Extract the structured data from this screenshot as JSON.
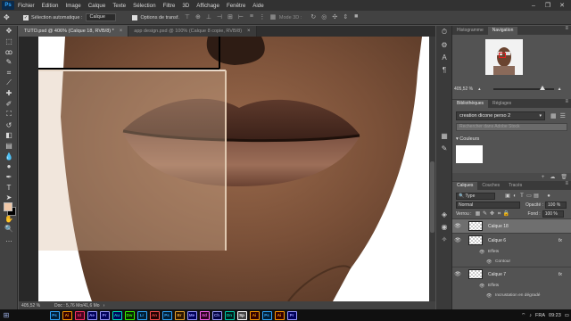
{
  "menu": [
    "Fichier",
    "Edition",
    "Image",
    "Calque",
    "Texte",
    "Sélection",
    "Filtre",
    "3D",
    "Affichage",
    "Fenêtre",
    "Aide"
  ],
  "app_logo": "Ps",
  "window_controls": [
    "–",
    "❐",
    "✕"
  ],
  "options_bar": {
    "auto_select_label": "Sélection automatique :",
    "auto_select_value": "Calque",
    "transform_label": "Options de transf.",
    "mode3d_label": "Mode 3D :"
  },
  "doc_tabs": [
    {
      "label": "TUTO.psd @ 406% (Calque 18, RVB/8) *",
      "close": "×"
    },
    {
      "label": "app design.psd @ 100% (Calque 8 copie, RVB/8)",
      "close": "×"
    }
  ],
  "status": {
    "zoom": "405,52 %",
    "doc": "Doc : 5,76 Mo/41,6 Mo",
    "arrow": "›"
  },
  "navigator": {
    "tabs": [
      "Histogramme",
      "Navigation"
    ],
    "active_tab": "Navigation",
    "zoom": "405,52 %",
    "zoom_value": 405.52
  },
  "libraries": {
    "tabs": [
      "Bibliothèques",
      "Réglages"
    ],
    "active_tab": "Bibliothèques",
    "library": "creation dicone perso 2",
    "search_placeholder": "Rechercher dans Adobe Stock",
    "section": "Couleurs",
    "color": "#ffffff"
  },
  "layers": {
    "tabs": [
      "Calques",
      "Couches",
      "Tracés"
    ],
    "active_tab": "Calques",
    "filter": "Type",
    "blend_mode": "Normal",
    "opacity_label": "Opacité :",
    "opacity": "100 %",
    "lock_label": "Verrou :",
    "fill_label": "Fond :",
    "fill": "100 %",
    "items": [
      {
        "name": "Calque 18",
        "selected": true,
        "fx": false,
        "effects": []
      },
      {
        "name": "Calque 6",
        "selected": false,
        "fx": true,
        "effects_label": "Effets",
        "effects": [
          "Contour"
        ]
      },
      {
        "name": "Calque 7",
        "selected": false,
        "fx": true,
        "effects_label": "Effets",
        "effects": [
          "Incrustation en dégradé"
        ]
      }
    ],
    "fx_label": "fx"
  },
  "taskbar": {
    "apps": [
      {
        "label": "Ps",
        "color": "#31a8ff",
        "bg": "#001e36"
      },
      {
        "label": "Ai",
        "color": "#ff9a00",
        "bg": "#330000"
      },
      {
        "label": "Id",
        "color": "#ff3366",
        "bg": "#49021f"
      },
      {
        "label": "Ae",
        "color": "#9999ff",
        "bg": "#00005b"
      },
      {
        "label": "Pr",
        "color": "#9999ff",
        "bg": "#00005b"
      },
      {
        "label": "Au",
        "color": "#00e4bb",
        "bg": "#00005b"
      },
      {
        "label": "Dw",
        "color": "#35fa00",
        "bg": "#072401"
      },
      {
        "label": "Lr",
        "color": "#31a8ff",
        "bg": "#001e36"
      },
      {
        "label": "An",
        "color": "#ff4d4d",
        "bg": "#210000"
      },
      {
        "label": "Ps",
        "color": "#31a8ff",
        "bg": "#001e36"
      },
      {
        "label": "Br",
        "color": "#e7a42c",
        "bg": "#2b1500"
      },
      {
        "label": "Me",
        "color": "#9999ff",
        "bg": "#00005b"
      },
      {
        "label": "Xd",
        "color": "#ff61f6",
        "bg": "#2e001f"
      },
      {
        "label": "Ch",
        "color": "#a2a3ff",
        "bg": "#000041"
      },
      {
        "label": "Dn",
        "color": "#00d2ae",
        "bg": "#001b19"
      },
      {
        "label": "Sp",
        "color": "#ffffff",
        "bg": "#444444"
      },
      {
        "label": "Ai",
        "color": "#ff9a00",
        "bg": "#330000"
      },
      {
        "label": "Ps",
        "color": "#31a8ff",
        "bg": "#001e36"
      },
      {
        "label": "Ai",
        "color": "#ff9a00",
        "bg": "#330000"
      },
      {
        "label": "Pr",
        "color": "#9999ff",
        "bg": "#00005b"
      }
    ],
    "lang": "FRA",
    "time": "09:23"
  },
  "colors": {
    "accent": "#31a8ff",
    "foreground_swatch": "#f0c8a8",
    "background_swatch": "#000000",
    "selection_outline": "#e02020"
  }
}
